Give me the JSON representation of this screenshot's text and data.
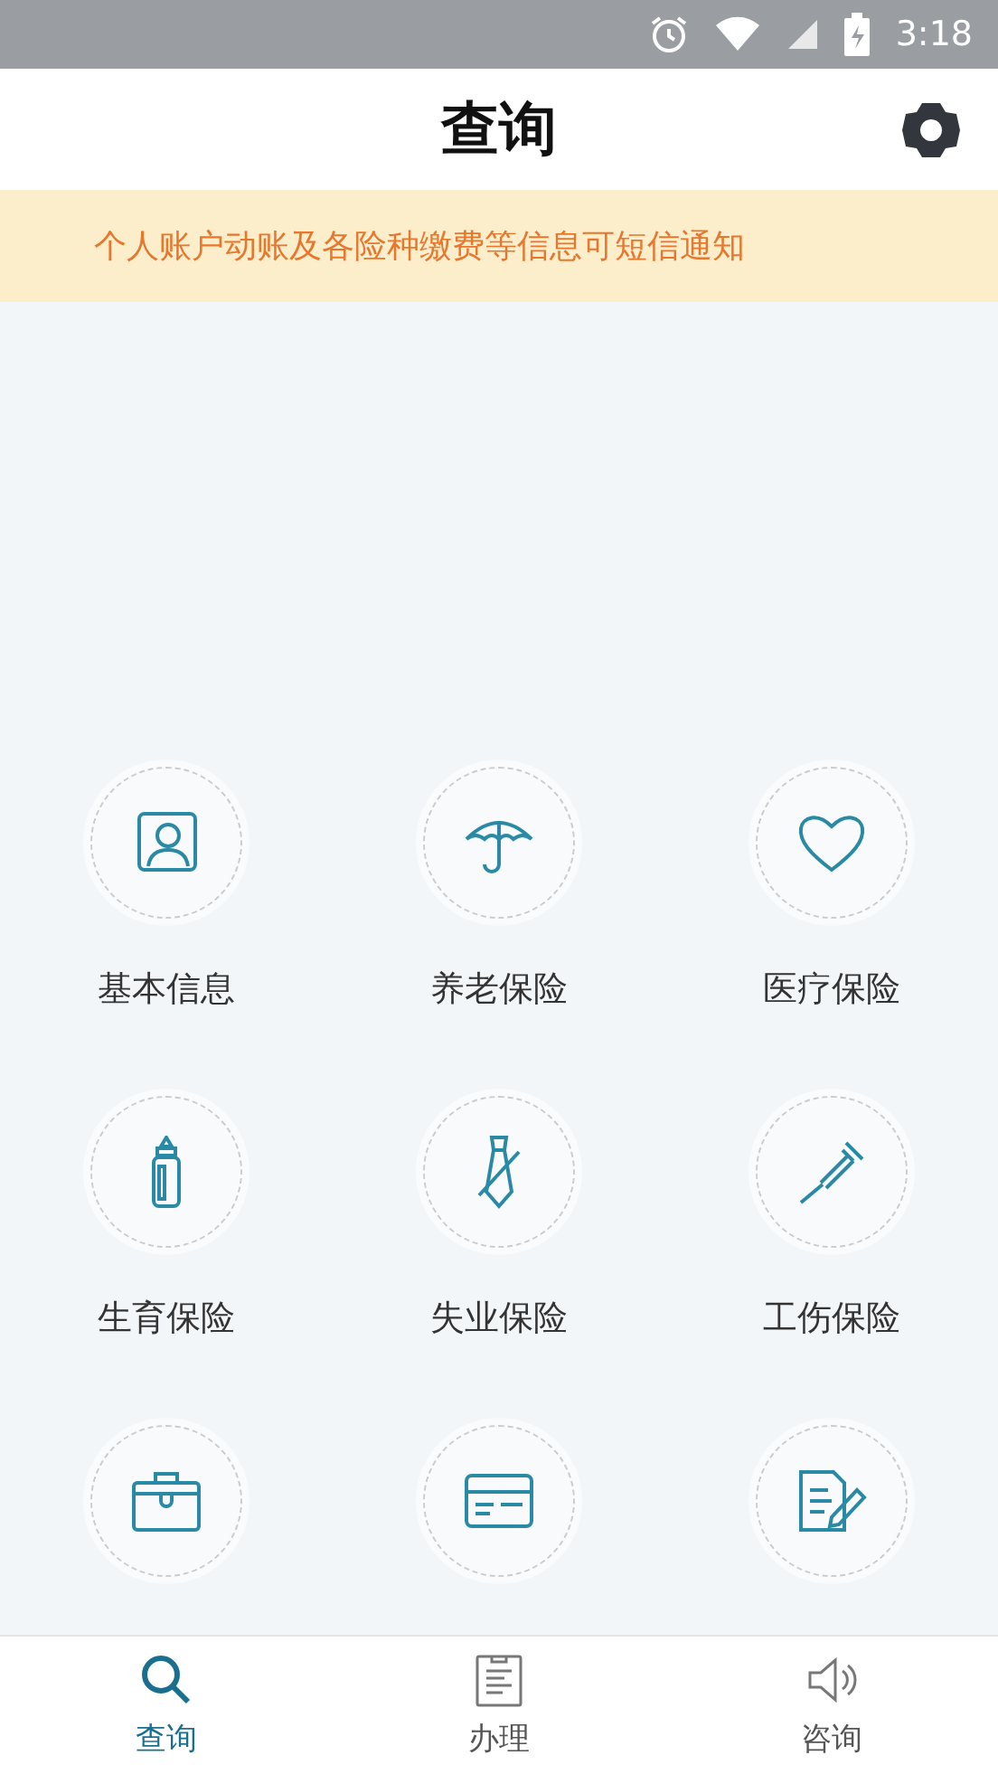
{
  "status_bar": {
    "time": "3:18"
  },
  "header": {
    "title": "查询"
  },
  "notice": {
    "text": "个人账户动账及各险种缴费等信息可短信通知"
  },
  "services": [
    {
      "kind": "labeled",
      "label": "基本信息"
    },
    {
      "kind": "labeled",
      "label": "养老保险"
    },
    {
      "kind": "labeled",
      "label": "医疗保险"
    },
    {
      "kind": "labeled",
      "label": "生育保险"
    },
    {
      "kind": "labeled",
      "label": "失业保险"
    },
    {
      "kind": "labeled",
      "label": "工伤保险"
    },
    {
      "kind": "icon_only"
    },
    {
      "kind": "icon_only"
    },
    {
      "kind": "icon_only"
    }
  ],
  "tabs": [
    {
      "label": "查询",
      "selected": true
    },
    {
      "label": "办理",
      "selected": false
    },
    {
      "label": "咨询",
      "selected": false
    }
  ]
}
